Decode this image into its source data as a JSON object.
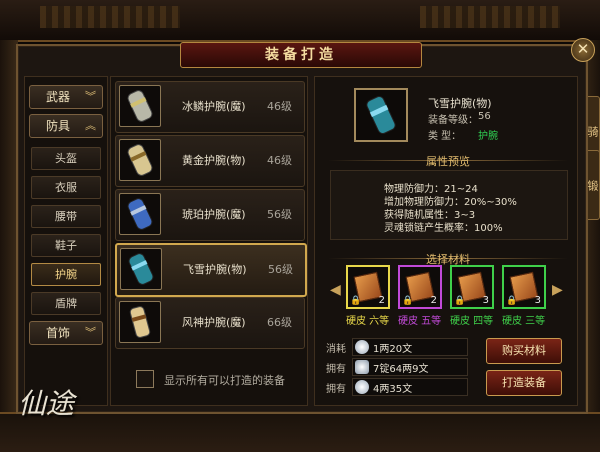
{
  "window": {
    "title": "装备打造"
  },
  "side_tabs": [
    "骑",
    "锻"
  ],
  "categories": {
    "weapon": "武器",
    "armor": "防具",
    "armor_subs": [
      "头盔",
      "衣服",
      "腰带",
      "鞋子",
      "护腕",
      "盾牌"
    ],
    "jewelry": "首饰",
    "active_sub_index": 4
  },
  "items": [
    {
      "name": "冰鳞护腕(魔)",
      "level": "46级",
      "icon": "bracer-icon"
    },
    {
      "name": "黄金护腕(物)",
      "level": "46级",
      "icon": "bracer-icon"
    },
    {
      "name": "琥珀护腕(魔)",
      "level": "56级",
      "icon": "bracer-icon"
    },
    {
      "name": "飞雪护腕(物)",
      "level": "56级",
      "icon": "bracer-icon"
    },
    {
      "name": "风神护腕(魔)",
      "level": "66级",
      "icon": "bracer-icon"
    }
  ],
  "selected_item_index": 3,
  "show_all_label": "显示所有可以打造的装备",
  "detail": {
    "name": "飞雪护腕(物)",
    "level_label": "装备等级：",
    "level_value": "56",
    "type_label": "类    型：",
    "type_value": "护腕",
    "preview_title": "属性预览",
    "attributes": [
      "物理防御力：21~24",
      "增加物理防御力：20%~30%",
      "获得随机属性：3~3",
      "灵魂锁链产生概率：100%"
    ],
    "materials_title": "选择材料",
    "materials": [
      {
        "count": "2",
        "label": "硬皮  六等",
        "color": "#e8d84a"
      },
      {
        "count": "2",
        "label": "硬皮  五等",
        "color": "#c24ad8"
      },
      {
        "count": "3",
        "label": "硬皮  四等",
        "color": "#3fd04a"
      },
      {
        "count": "3",
        "label": "硬皮  三等",
        "color": "#3fd04a"
      }
    ]
  },
  "costs": {
    "consume_label": "消耗",
    "consume_value": "1两20文",
    "own_label": "拥有",
    "own_ingot_value": "7锭64两9文",
    "own_silver_value": "4两35文"
  },
  "buttons": {
    "buy_materials": "购买材料",
    "craft": "打造装备"
  },
  "logo": {
    "text": "仙途"
  }
}
